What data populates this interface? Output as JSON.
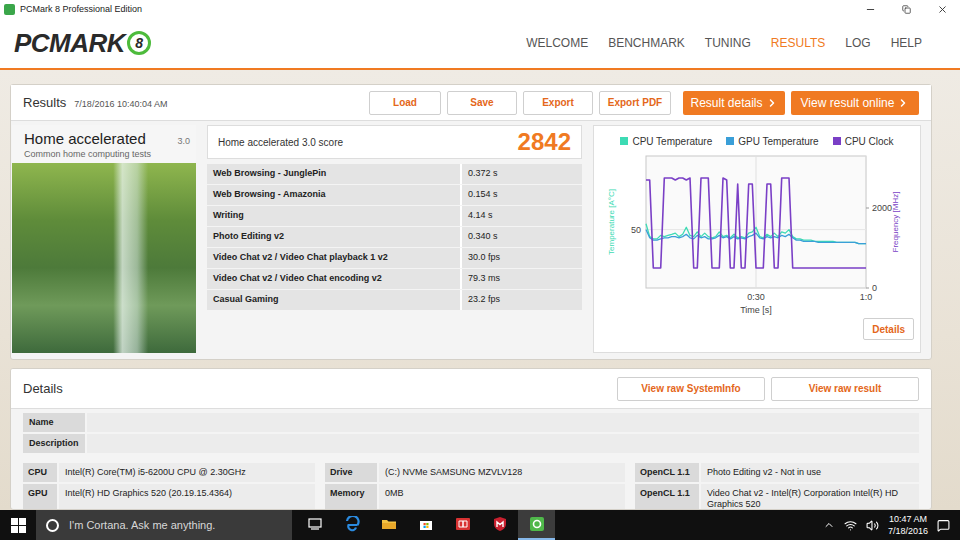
{
  "window": {
    "title": "PCMark 8 Professional Edition"
  },
  "logo": {
    "text": "PCMARK",
    "version": "8"
  },
  "nav": [
    {
      "label": "WELCOME",
      "selected": false
    },
    {
      "label": "BENCHMARK",
      "selected": false
    },
    {
      "label": "TUNING",
      "selected": false
    },
    {
      "label": "RESULTS",
      "selected": true
    },
    {
      "label": "LOG",
      "selected": false
    },
    {
      "label": "HELP",
      "selected": false
    }
  ],
  "results": {
    "title": "Results",
    "timestamp": "7/18/2016 10:40:04 AM",
    "buttons": [
      "Load",
      "Save",
      "Export",
      "Export PDF"
    ],
    "primary_buttons": [
      "Result details",
      "View result online"
    ]
  },
  "benchmark": {
    "name": "Home accelerated",
    "version": "3.0",
    "description": "Common home computing tests"
  },
  "score": {
    "label": "Home accelerated 3.0 score",
    "value": "2842"
  },
  "tests": [
    {
      "name": "Web Browsing - JunglePin",
      "value": "0.372 s"
    },
    {
      "name": "Web Browsing - Amazonia",
      "value": "0.154 s"
    },
    {
      "name": "Writing",
      "value": "4.14 s"
    },
    {
      "name": "Photo Editing v2",
      "value": "0.340 s"
    },
    {
      "name": "Video Chat v2 / Video Chat playback 1 v2",
      "value": "30.0 fps"
    },
    {
      "name": "Video Chat v2 / Video Chat encoding v2",
      "value": "79.3 ms"
    },
    {
      "name": "Casual Gaming",
      "value": "23.2 fps"
    }
  ],
  "chart": {
    "series": [
      {
        "name": "CPU Temperature",
        "color": "#3ddbb4",
        "axis": "left",
        "values": [
          55,
          44,
          42,
          42,
          45,
          44,
          45,
          46,
          47,
          44,
          46,
          52,
          45,
          44,
          48,
          44,
          47,
          44,
          43,
          44,
          48,
          44,
          45,
          43,
          46,
          43,
          44,
          43,
          47,
          48,
          52,
          44,
          43,
          46,
          44,
          47,
          44,
          48,
          47,
          50,
          44,
          42,
          42,
          41,
          41,
          41,
          40,
          40,
          40,
          40,
          40,
          40,
          39,
          39,
          39,
          39,
          39,
          39,
          38,
          38,
          38
        ]
      },
      {
        "name": "GPU Temperature",
        "color": "#3a9fd8",
        "axis": "left",
        "values": [
          50,
          43,
          41,
          41,
          42,
          43,
          43,
          44,
          44,
          43,
          44,
          46,
          43,
          42,
          45,
          43,
          44,
          42,
          42,
          43,
          45,
          43,
          44,
          42,
          44,
          42,
          43,
          42,
          44,
          45,
          47,
          43,
          42,
          44,
          43,
          44,
          43,
          45,
          44,
          46,
          43,
          41,
          41,
          40,
          40,
          40,
          40,
          39,
          39,
          39,
          39,
          39,
          39,
          39,
          39,
          39,
          39,
          39,
          38,
          38,
          38
        ]
      },
      {
        "name": "CPU Clock",
        "color": "#7a3fc6",
        "axis": "right",
        "values": [
          2700,
          2700,
          500,
          500,
          500,
          2750,
          2750,
          2750,
          2700,
          2750,
          2750,
          2700,
          2750,
          500,
          500,
          2750,
          2750,
          2750,
          500,
          500,
          500,
          2750,
          2700,
          500,
          500,
          2600,
          500,
          500,
          2600,
          2600,
          500,
          500,
          500,
          2600,
          2600,
          500,
          500,
          2750,
          2750,
          2750,
          500,
          500,
          500,
          500,
          500,
          500,
          500,
          500,
          500,
          500,
          500,
          500,
          500,
          500,
          500,
          500,
          500,
          500,
          500,
          500,
          500
        ]
      }
    ],
    "left_axis": {
      "label": "Temperature [A°C]",
      "ticks": [
        "50"
      ]
    },
    "right_axis": {
      "label": "Frequency [MHz]",
      "ticks": [
        "2000",
        "0"
      ]
    },
    "x_axis": {
      "label": "Time [s]",
      "ticks": [
        "0:30",
        "1:0"
      ]
    },
    "details_button": "Details"
  },
  "details": {
    "title": "Details",
    "buttons": [
      "View raw SystemInfo",
      "View raw result"
    ],
    "fields": [
      {
        "label": "Name",
        "value": ""
      },
      {
        "label": "Description",
        "value": ""
      }
    ],
    "specs": [
      {
        "label": "CPU",
        "value": "Intel(R) Core(TM) i5-6200U CPU @ 2.30GHz"
      },
      {
        "label": "Drive",
        "value": "(C:) NVMe SAMSUNG MZVLV128"
      },
      {
        "label": "OpenCL 1.1",
        "value": "Photo Editing v2 - Not in use"
      },
      {
        "label": "GPU",
        "value": "Intel(R) HD Graphics 520 (20.19.15.4364)"
      },
      {
        "label": "Memory",
        "value": "0MB"
      },
      {
        "label": "OpenCL 1.1",
        "value": "Video Chat v2 - Intel(R) Corporation Intel(R) HD Graphics 520"
      }
    ]
  },
  "taskbar": {
    "search_placeholder": "I'm Cortana. Ask me anything.",
    "apps": [
      {
        "kind": "taskview",
        "active": false
      },
      {
        "kind": "edge",
        "active": false
      },
      {
        "kind": "explorer",
        "active": false
      },
      {
        "kind": "store",
        "active": false
      },
      {
        "kind": "reader",
        "active": false
      },
      {
        "kind": "mcafee",
        "active": false
      },
      {
        "kind": "pcmark",
        "active": true
      }
    ],
    "clock": {
      "time": "10:47 AM",
      "date": "7/18/2016"
    }
  }
}
